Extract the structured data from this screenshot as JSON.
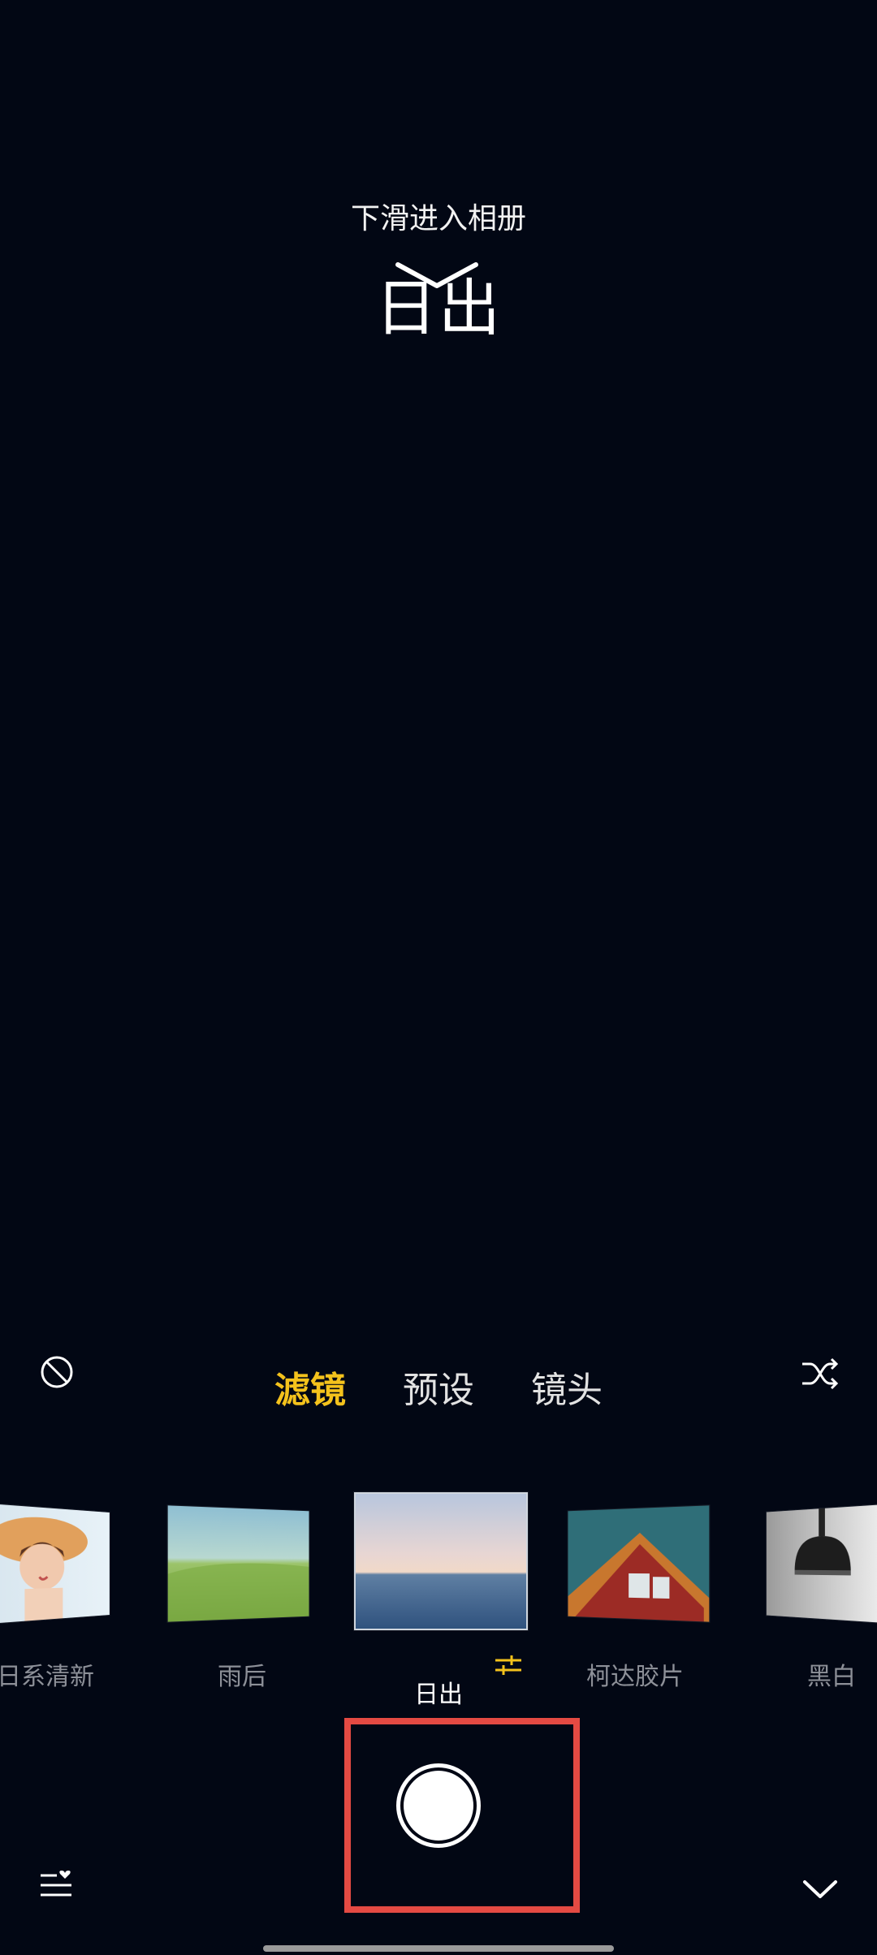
{
  "top": {
    "hint": "下滑进入相册",
    "filter_name": "日出"
  },
  "tabs": [
    {
      "label": "滤镜",
      "active": true
    },
    {
      "label": "预设",
      "active": false
    },
    {
      "label": "镜头",
      "active": false
    }
  ],
  "filters": [
    {
      "label": "日系清新"
    },
    {
      "label": "雨后"
    },
    {
      "label": "日出",
      "selected": true
    },
    {
      "label": "柯达胶片"
    },
    {
      "label": "黑白"
    }
  ],
  "icons": {
    "no_filter": "no-filter-icon",
    "shuffle": "shuffle-icon",
    "adjust": "adjust-sliders-icon",
    "favorites": "favorite-list-icon",
    "collapse": "chevron-down-icon"
  },
  "colors": {
    "background": "#020714",
    "accent": "#f4c21c",
    "highlight": "#e44a43"
  }
}
